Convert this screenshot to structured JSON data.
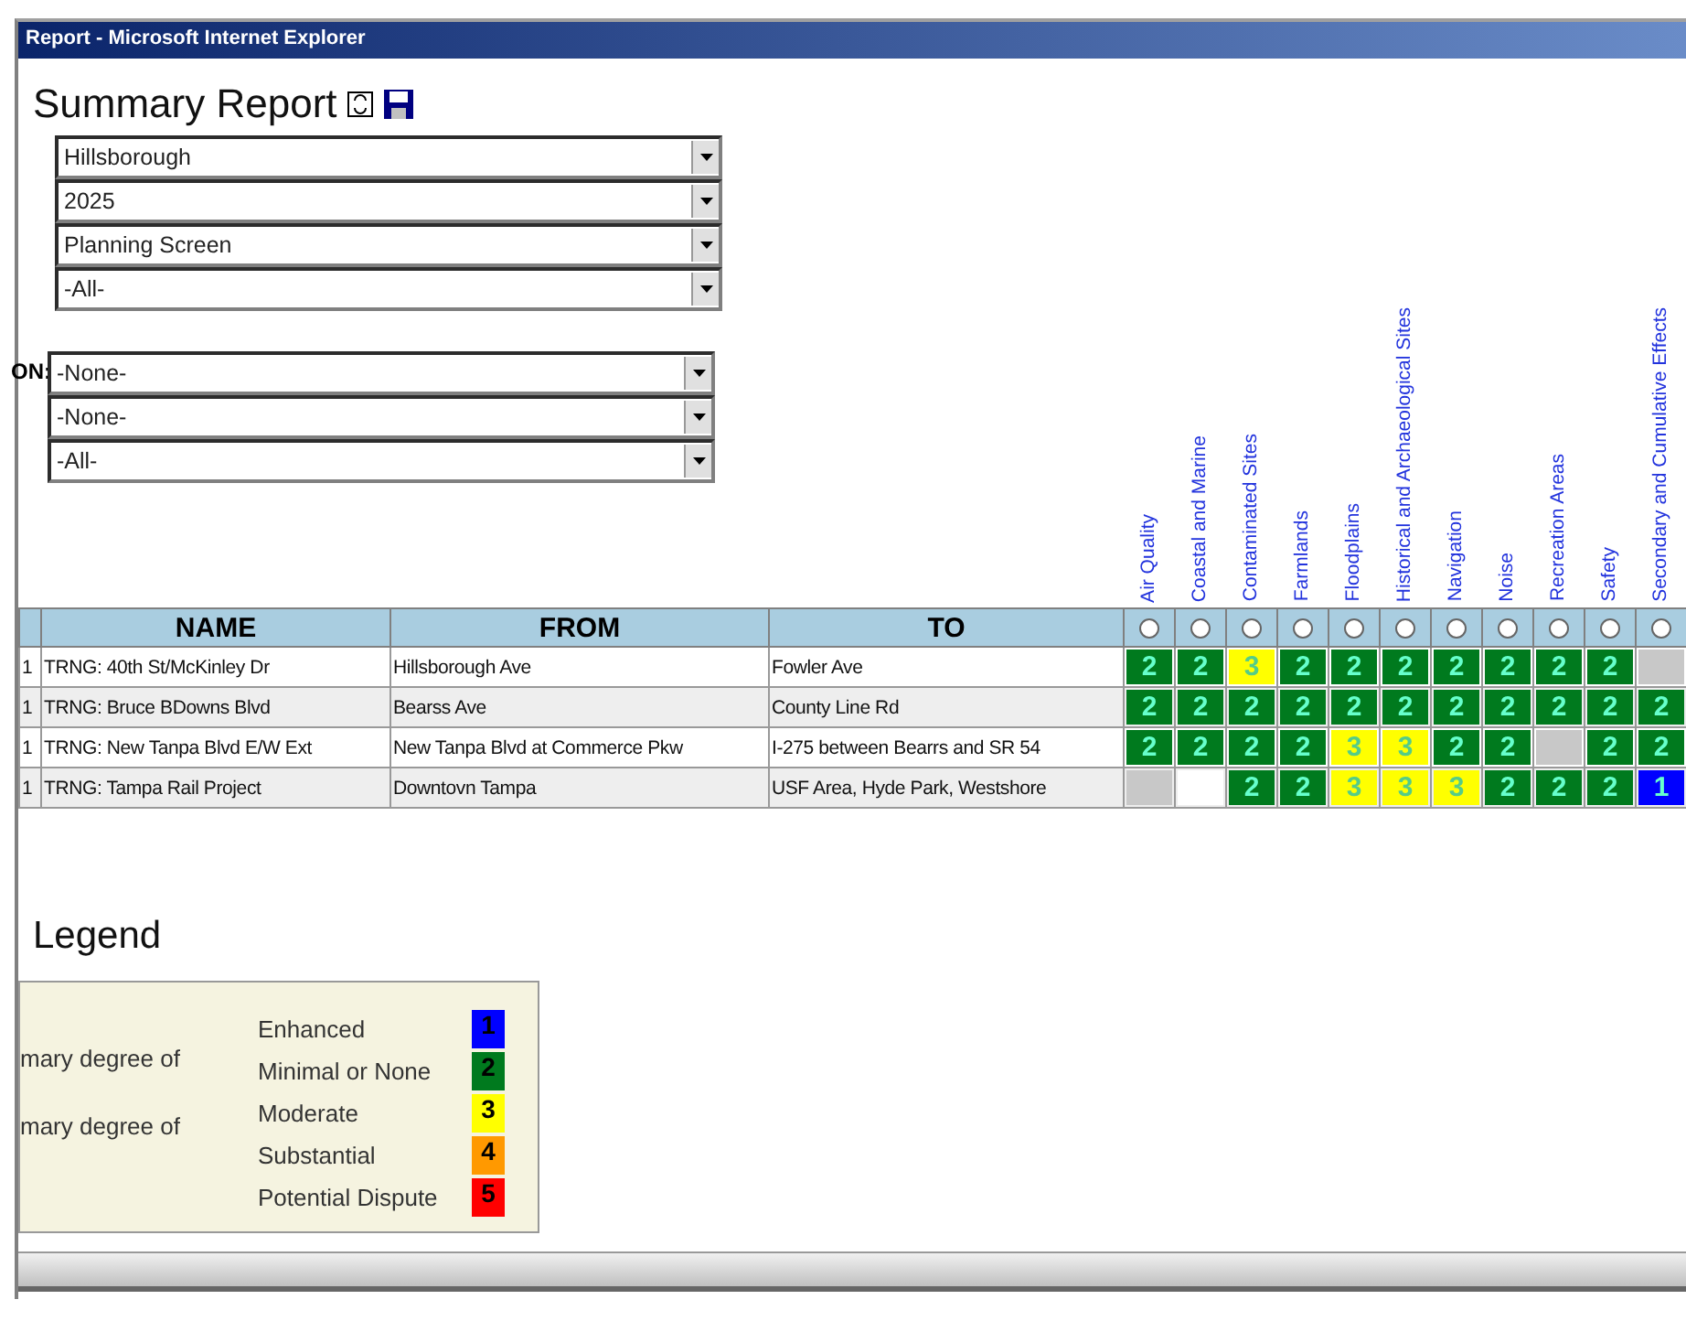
{
  "window": {
    "title": "Report - Microsoft Internet Explorer"
  },
  "page_title": "Summary Report",
  "filters": [
    {
      "value": "Hillsborough"
    },
    {
      "value": "2025"
    },
    {
      "value": "Planning Screen"
    },
    {
      "value": "-All-"
    }
  ],
  "filters_2": {
    "label": "ON:",
    "selects": [
      {
        "value": "-None-"
      },
      {
        "value": "-None-"
      },
      {
        "value": "-All-"
      }
    ]
  },
  "table": {
    "columns": [
      "NAME",
      "FROM",
      "TO"
    ],
    "criteria": [
      {
        "label": "Air Quality",
        "selected": false
      },
      {
        "label": "Coastal and Marine",
        "selected": false
      },
      {
        "label": "Contaminated Sites",
        "selected": false
      },
      {
        "label": "Farmlands",
        "selected": false
      },
      {
        "label": "Floodplains",
        "selected": false
      },
      {
        "label": "Historical and Archaeological Sites",
        "selected": false
      },
      {
        "label": "Navigation",
        "selected": false
      },
      {
        "label": "Noise",
        "selected": false
      },
      {
        "label": "Recreation Areas",
        "selected": false
      },
      {
        "label": "Safety",
        "selected": false
      },
      {
        "label": "Secondary and Cumulative Effects",
        "selected": false
      }
    ],
    "rows": [
      {
        "index": "1",
        "name": "TRNG: 40th St/McKinley Dr",
        "from": "Hillsborough Ave",
        "to": "Fowler Ave",
        "ratings": [
          {
            "text": "2",
            "color": "#007a1e"
          },
          {
            "text": "2",
            "color": "#007a1e"
          },
          {
            "text": "3",
            "color": "#ffff00"
          },
          {
            "text": "2",
            "color": "#007a1e"
          },
          {
            "text": "2",
            "color": "#007a1e"
          },
          {
            "text": "2",
            "color": "#007a1e"
          },
          {
            "text": "2",
            "color": "#007a1e"
          },
          {
            "text": "2",
            "color": "#007a1e"
          },
          {
            "text": "2",
            "color": "#007a1e"
          },
          {
            "text": "2",
            "color": "#007a1e"
          },
          {
            "color": "#c8c8c8"
          }
        ]
      },
      {
        "index": "1",
        "name": "TRNG: Bruce BDowns Blvd",
        "from": "Bearss Ave",
        "to": "County Line Rd",
        "ratings": [
          {
            "text": "2",
            "color": "#007a1e"
          },
          {
            "text": "2",
            "color": "#007a1e"
          },
          {
            "text": "2",
            "color": "#007a1e"
          },
          {
            "text": "2",
            "color": "#007a1e"
          },
          {
            "text": "2",
            "color": "#007a1e"
          },
          {
            "text": "2",
            "color": "#007a1e"
          },
          {
            "text": "2",
            "color": "#007a1e"
          },
          {
            "text": "2",
            "color": "#007a1e"
          },
          {
            "text": "2",
            "color": "#007a1e"
          },
          {
            "text": "2",
            "color": "#007a1e"
          },
          {
            "text": "2",
            "color": "#007a1e"
          }
        ]
      },
      {
        "index": "1",
        "name": "TRNG: New Tanpa Blvd E/W Ext",
        "from": "New Tanpa Blvd at Commerce Pkw",
        "to": "I-275 between Bearrs and SR 54",
        "ratings": [
          {
            "text": "2",
            "color": "#007a1e"
          },
          {
            "text": "2",
            "color": "#007a1e"
          },
          {
            "text": "2",
            "color": "#007a1e"
          },
          {
            "text": "2",
            "color": "#007a1e"
          },
          {
            "text": "3",
            "color": "#ffff00"
          },
          {
            "text": "3",
            "color": "#ffff00"
          },
          {
            "text": "2",
            "color": "#007a1e"
          },
          {
            "text": "2",
            "color": "#007a1e"
          },
          {
            "color": "#c8c8c8"
          },
          {
            "text": "2",
            "color": "#007a1e"
          },
          {
            "text": "2",
            "color": "#007a1e"
          }
        ]
      },
      {
        "index": "1",
        "name": "TRNG: Tampa Rail Project",
        "from": "Downtovn Tampa",
        "to": "USF Area, Hyde Park, Westshore",
        "ratings": [
          {
            "color": "#c8c8c8"
          },
          {
            "color": "#ffffff"
          },
          {
            "text": "2",
            "color": "#007a1e"
          },
          {
            "text": "2",
            "color": "#007a1e"
          },
          {
            "text": "3",
            "color": "#ffff00"
          },
          {
            "text": "3",
            "color": "#ffff00"
          },
          {
            "text": "3",
            "color": "#ffff00"
          },
          {
            "text": "2",
            "color": "#007a1e"
          },
          {
            "text": "2",
            "color": "#007a1e"
          },
          {
            "text": "2",
            "color": "#007a1e"
          },
          {
            "text": "1",
            "color": "#0000ff"
          }
        ]
      }
    ]
  },
  "legend": {
    "title": "Legend",
    "notes": [
      "mary degree of",
      "mary degree of"
    ],
    "items": [
      {
        "label": "Enhanced",
        "number": "1",
        "color": "#0000ff"
      },
      {
        "label": "Minimal or None",
        "number": "2",
        "color": "#007a1e"
      },
      {
        "label": "Moderate",
        "number": "3",
        "color": "#ffff00"
      },
      {
        "label": "Substantial",
        "number": "4",
        "color": "#ff9900"
      },
      {
        "label": "Potential Dispute",
        "number": "5",
        "color": "#ff0000"
      }
    ]
  }
}
